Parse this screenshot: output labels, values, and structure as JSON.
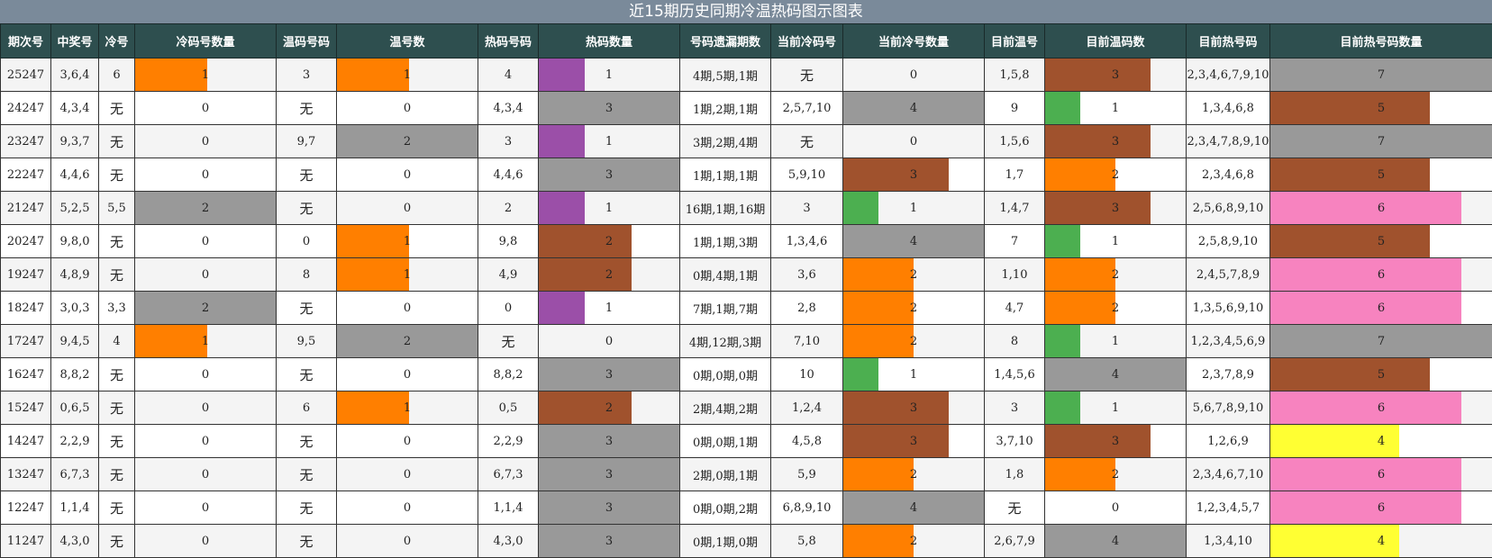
{
  "title": "近15期历史同期冷温热码图示图表",
  "headers": [
    "期次号",
    "中奖号",
    "冷号",
    "冷码号数量",
    "温码号码",
    "温号数",
    "热码号码",
    "热码数量",
    "号码遗漏期数",
    "当前冷码号",
    "当前冷号数量",
    "目前温号",
    "目前温码数",
    "目前热号码",
    "目前热号码数量"
  ],
  "colors": {
    "orange": "#ff7f00",
    "gray": "#999999",
    "purple": "#9b4fa8",
    "brown": "#a0522d",
    "green": "#4caf50",
    "pink": "#f783bf",
    "yellow": "#ffff33"
  },
  "rows": [
    {
      "issue": "25247",
      "win": "3,6,4",
      "cold": "6",
      "cold_count": {
        "v": "1",
        "c": "orange",
        "f": 0.51
      },
      "warm": "3",
      "warm_count": {
        "v": "1",
        "c": "orange",
        "f": 0.51
      },
      "hot": "4",
      "hot_count": {
        "v": "1",
        "c": "purple",
        "f": 0.33
      },
      "miss": "4期,5期,1期",
      "cur_cold": "无",
      "cur_cold_count": {
        "v": "0",
        "c": "",
        "f": 0
      },
      "cur_warm": "1,5,8",
      "cur_warm_count": {
        "v": "3",
        "c": "brown",
        "f": 0.75
      },
      "cur_hot": "2,3,4,6,7,9,10",
      "cur_hot_count": {
        "v": "7",
        "c": "gray",
        "f": 1
      }
    },
    {
      "issue": "24247",
      "win": "4,3,4",
      "cold": "无",
      "cold_count": {
        "v": "0",
        "c": "",
        "f": 0
      },
      "warm": "无",
      "warm_count": {
        "v": "0",
        "c": "",
        "f": 0
      },
      "hot": "4,3,4",
      "hot_count": {
        "v": "3",
        "c": "gray",
        "f": 1
      },
      "miss": "1期,2期,1期",
      "cur_cold": "2,5,7,10",
      "cur_cold_count": {
        "v": "4",
        "c": "gray",
        "f": 1
      },
      "cur_warm": "9",
      "cur_warm_count": {
        "v": "1",
        "c": "green",
        "f": 0.25
      },
      "cur_hot": "1,3,4,6,8",
      "cur_hot_count": {
        "v": "5",
        "c": "brown",
        "f": 0.72
      }
    },
    {
      "issue": "23247",
      "win": "9,3,7",
      "cold": "无",
      "cold_count": {
        "v": "0",
        "c": "",
        "f": 0
      },
      "warm": "9,7",
      "warm_count": {
        "v": "2",
        "c": "gray",
        "f": 1
      },
      "hot": "3",
      "hot_count": {
        "v": "1",
        "c": "purple",
        "f": 0.33
      },
      "miss": "3期,2期,4期",
      "cur_cold": "无",
      "cur_cold_count": {
        "v": "0",
        "c": "",
        "f": 0
      },
      "cur_warm": "1,5,6",
      "cur_warm_count": {
        "v": "3",
        "c": "brown",
        "f": 0.75
      },
      "cur_hot": "2,3,4,7,8,9,10",
      "cur_hot_count": {
        "v": "7",
        "c": "gray",
        "f": 1
      }
    },
    {
      "issue": "22247",
      "win": "4,4,6",
      "cold": "无",
      "cold_count": {
        "v": "0",
        "c": "",
        "f": 0
      },
      "warm": "无",
      "warm_count": {
        "v": "0",
        "c": "",
        "f": 0
      },
      "hot": "4,4,6",
      "hot_count": {
        "v": "3",
        "c": "gray",
        "f": 1
      },
      "miss": "1期,1期,1期",
      "cur_cold": "5,9,10",
      "cur_cold_count": {
        "v": "3",
        "c": "brown",
        "f": 0.75
      },
      "cur_warm": "1,7",
      "cur_warm_count": {
        "v": "2",
        "c": "orange",
        "f": 0.5
      },
      "cur_hot": "2,3,4,6,8",
      "cur_hot_count": {
        "v": "5",
        "c": "brown",
        "f": 0.72
      }
    },
    {
      "issue": "21247",
      "win": "5,2,5",
      "cold": "5,5",
      "cold_count": {
        "v": "2",
        "c": "gray",
        "f": 1
      },
      "warm": "无",
      "warm_count": {
        "v": "0",
        "c": "",
        "f": 0
      },
      "hot": "2",
      "hot_count": {
        "v": "1",
        "c": "purple",
        "f": 0.33
      },
      "miss": "16期,1期,16期",
      "cur_cold": "3",
      "cur_cold_count": {
        "v": "1",
        "c": "green",
        "f": 0.25
      },
      "cur_warm": "1,4,7",
      "cur_warm_count": {
        "v": "3",
        "c": "brown",
        "f": 0.75
      },
      "cur_hot": "2,5,6,8,9,10",
      "cur_hot_count": {
        "v": "6",
        "c": "pink",
        "f": 0.86
      }
    },
    {
      "issue": "20247",
      "win": "9,8,0",
      "cold": "无",
      "cold_count": {
        "v": "0",
        "c": "",
        "f": 0
      },
      "warm": "0",
      "warm_count": {
        "v": "1",
        "c": "orange",
        "f": 0.51
      },
      "hot": "9,8",
      "hot_count": {
        "v": "2",
        "c": "brown",
        "f": 0.66
      },
      "miss": "1期,1期,3期",
      "cur_cold": "1,3,4,6",
      "cur_cold_count": {
        "v": "4",
        "c": "gray",
        "f": 1
      },
      "cur_warm": "7",
      "cur_warm_count": {
        "v": "1",
        "c": "green",
        "f": 0.25
      },
      "cur_hot": "2,5,8,9,10",
      "cur_hot_count": {
        "v": "5",
        "c": "brown",
        "f": 0.72
      }
    },
    {
      "issue": "19247",
      "win": "4,8,9",
      "cold": "无",
      "cold_count": {
        "v": "0",
        "c": "",
        "f": 0
      },
      "warm": "8",
      "warm_count": {
        "v": "1",
        "c": "orange",
        "f": 0.51
      },
      "hot": "4,9",
      "hot_count": {
        "v": "2",
        "c": "brown",
        "f": 0.66
      },
      "miss": "0期,4期,1期",
      "cur_cold": "3,6",
      "cur_cold_count": {
        "v": "2",
        "c": "orange",
        "f": 0.5
      },
      "cur_warm": "1,10",
      "cur_warm_count": {
        "v": "2",
        "c": "orange",
        "f": 0.5
      },
      "cur_hot": "2,4,5,7,8,9",
      "cur_hot_count": {
        "v": "6",
        "c": "pink",
        "f": 0.86
      }
    },
    {
      "issue": "18247",
      "win": "3,0,3",
      "cold": "3,3",
      "cold_count": {
        "v": "2",
        "c": "gray",
        "f": 1
      },
      "warm": "无",
      "warm_count": {
        "v": "0",
        "c": "",
        "f": 0
      },
      "hot": "0",
      "hot_count": {
        "v": "1",
        "c": "purple",
        "f": 0.33
      },
      "miss": "7期,1期,7期",
      "cur_cold": "2,8",
      "cur_cold_count": {
        "v": "2",
        "c": "orange",
        "f": 0.5
      },
      "cur_warm": "4,7",
      "cur_warm_count": {
        "v": "2",
        "c": "orange",
        "f": 0.5
      },
      "cur_hot": "1,3,5,6,9,10",
      "cur_hot_count": {
        "v": "6",
        "c": "pink",
        "f": 0.86
      }
    },
    {
      "issue": "17247",
      "win": "9,4,5",
      "cold": "4",
      "cold_count": {
        "v": "1",
        "c": "orange",
        "f": 0.51
      },
      "warm": "9,5",
      "warm_count": {
        "v": "2",
        "c": "gray",
        "f": 1
      },
      "hot": "无",
      "hot_count": {
        "v": "0",
        "c": "",
        "f": 0
      },
      "miss": "4期,12期,3期",
      "cur_cold": "7,10",
      "cur_cold_count": {
        "v": "2",
        "c": "orange",
        "f": 0.5
      },
      "cur_warm": "8",
      "cur_warm_count": {
        "v": "1",
        "c": "green",
        "f": 0.25
      },
      "cur_hot": "1,2,3,4,5,6,9",
      "cur_hot_count": {
        "v": "7",
        "c": "gray",
        "f": 1
      }
    },
    {
      "issue": "16247",
      "win": "8,8,2",
      "cold": "无",
      "cold_count": {
        "v": "0",
        "c": "",
        "f": 0
      },
      "warm": "无",
      "warm_count": {
        "v": "0",
        "c": "",
        "f": 0
      },
      "hot": "8,8,2",
      "hot_count": {
        "v": "3",
        "c": "gray",
        "f": 1
      },
      "miss": "0期,0期,0期",
      "cur_cold": "10",
      "cur_cold_count": {
        "v": "1",
        "c": "green",
        "f": 0.25
      },
      "cur_warm": "1,4,5,6",
      "cur_warm_count": {
        "v": "4",
        "c": "gray",
        "f": 1
      },
      "cur_hot": "2,3,7,8,9",
      "cur_hot_count": {
        "v": "5",
        "c": "brown",
        "f": 0.72
      }
    },
    {
      "issue": "15247",
      "win": "0,6,5",
      "cold": "无",
      "cold_count": {
        "v": "0",
        "c": "",
        "f": 0
      },
      "warm": "6",
      "warm_count": {
        "v": "1",
        "c": "orange",
        "f": 0.51
      },
      "hot": "0,5",
      "hot_count": {
        "v": "2",
        "c": "brown",
        "f": 0.66
      },
      "miss": "2期,4期,2期",
      "cur_cold": "1,2,4",
      "cur_cold_count": {
        "v": "3",
        "c": "brown",
        "f": 0.75
      },
      "cur_warm": "3",
      "cur_warm_count": {
        "v": "1",
        "c": "green",
        "f": 0.25
      },
      "cur_hot": "5,6,7,8,9,10",
      "cur_hot_count": {
        "v": "6",
        "c": "pink",
        "f": 0.86
      }
    },
    {
      "issue": "14247",
      "win": "2,2,9",
      "cold": "无",
      "cold_count": {
        "v": "0",
        "c": "",
        "f": 0
      },
      "warm": "无",
      "warm_count": {
        "v": "0",
        "c": "",
        "f": 0
      },
      "hot": "2,2,9",
      "hot_count": {
        "v": "3",
        "c": "gray",
        "f": 1
      },
      "miss": "0期,0期,1期",
      "cur_cold": "4,5,8",
      "cur_cold_count": {
        "v": "3",
        "c": "brown",
        "f": 0.75
      },
      "cur_warm": "3,7,10",
      "cur_warm_count": {
        "v": "3",
        "c": "brown",
        "f": 0.75
      },
      "cur_hot": "1,2,6,9",
      "cur_hot_count": {
        "v": "4",
        "c": "yellow",
        "f": 0.58
      }
    },
    {
      "issue": "13247",
      "win": "6,7,3",
      "cold": "无",
      "cold_count": {
        "v": "0",
        "c": "",
        "f": 0
      },
      "warm": "无",
      "warm_count": {
        "v": "0",
        "c": "",
        "f": 0
      },
      "hot": "6,7,3",
      "hot_count": {
        "v": "3",
        "c": "gray",
        "f": 1
      },
      "miss": "2期,0期,1期",
      "cur_cold": "5,9",
      "cur_cold_count": {
        "v": "2",
        "c": "orange",
        "f": 0.5
      },
      "cur_warm": "1,8",
      "cur_warm_count": {
        "v": "2",
        "c": "orange",
        "f": 0.5
      },
      "cur_hot": "2,3,4,6,7,10",
      "cur_hot_count": {
        "v": "6",
        "c": "pink",
        "f": 0.86
      }
    },
    {
      "issue": "12247",
      "win": "1,1,4",
      "cold": "无",
      "cold_count": {
        "v": "0",
        "c": "",
        "f": 0
      },
      "warm": "无",
      "warm_count": {
        "v": "0",
        "c": "",
        "f": 0
      },
      "hot": "1,1,4",
      "hot_count": {
        "v": "3",
        "c": "gray",
        "f": 1
      },
      "miss": "0期,0期,2期",
      "cur_cold": "6,8,9,10",
      "cur_cold_count": {
        "v": "4",
        "c": "gray",
        "f": 1
      },
      "cur_warm": "无",
      "cur_warm_count": {
        "v": "0",
        "c": "",
        "f": 0
      },
      "cur_hot": "1,2,3,4,5,7",
      "cur_hot_count": {
        "v": "6",
        "c": "pink",
        "f": 0.86
      }
    },
    {
      "issue": "11247",
      "win": "4,3,0",
      "cold": "无",
      "cold_count": {
        "v": "0",
        "c": "",
        "f": 0
      },
      "warm": "无",
      "warm_count": {
        "v": "0",
        "c": "",
        "f": 0
      },
      "hot": "4,3,0",
      "hot_count": {
        "v": "3",
        "c": "gray",
        "f": 1
      },
      "miss": "0期,1期,0期",
      "cur_cold": "5,8",
      "cur_cold_count": {
        "v": "2",
        "c": "orange",
        "f": 0.5
      },
      "cur_warm": "2,6,7,9",
      "cur_warm_count": {
        "v": "4",
        "c": "gray",
        "f": 1
      },
      "cur_hot": "1,3,4,10",
      "cur_hot_count": {
        "v": "4",
        "c": "yellow",
        "f": 0.58
      }
    }
  ]
}
